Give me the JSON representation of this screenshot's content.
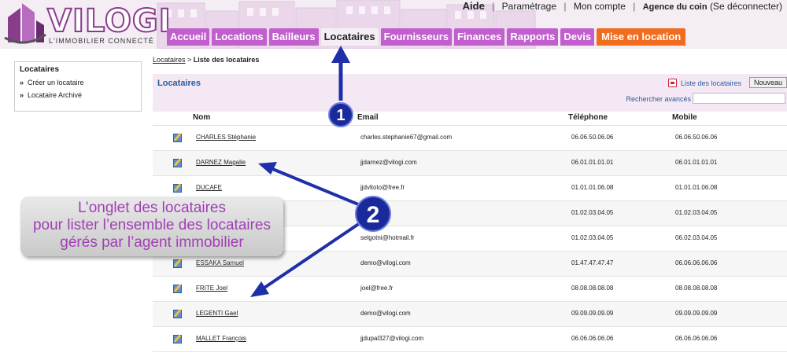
{
  "header": {
    "logo_text": "VILOGI",
    "logo_tagline": "L'IMMOBILIER CONNECTÉ",
    "top_links": [
      "Aide",
      "Paramétrage",
      "Mon compte"
    ],
    "agency_text": "Agence du coin",
    "logout_text": "(Se déconnecter)"
  },
  "tabs": [
    {
      "label": "Accueil"
    },
    {
      "label": "Locations"
    },
    {
      "label": "Bailleurs"
    },
    {
      "label": "Locataires"
    },
    {
      "label": "Fournisseurs"
    },
    {
      "label": "Finances"
    },
    {
      "label": "Rapports"
    },
    {
      "label": "Devis"
    },
    {
      "label": "Mise en location"
    }
  ],
  "sidebar": {
    "title": "Locataires",
    "items": [
      {
        "label": "Créer un locataire"
      },
      {
        "label": "Locataire Archivé"
      }
    ]
  },
  "breadcrumb": {
    "link": "Locataires",
    "separator": " > ",
    "current": "Liste des locataires"
  },
  "panel": {
    "title": "Locataires",
    "list_link": "Liste des locataires",
    "new_button": "Nouveau",
    "advanced_search": "Rechercher avancés",
    "columns": {
      "name": "Nom",
      "email": "Email",
      "phone": "Téléphone",
      "mobile": "Mobile"
    }
  },
  "rows": [
    {
      "name": "CHARLES Stéphanie",
      "email": "charles.stephanie67@gmail.com",
      "phone": "06.06.50.06.06",
      "mobile": "06.06.50.06.06"
    },
    {
      "name": "DARNEZ Magalie",
      "email": "jjdarnez@vilogi.com",
      "phone": "06.01.01.01.01",
      "mobile": "06.01.01.01.01"
    },
    {
      "name": "DUCAFE",
      "email": "jjdvltoto@free.fr",
      "phone": "01.01.01.06.08",
      "mobile": "01.01.01.06.08"
    },
    {
      "name": "",
      "email": "jj...gi.com",
      "phone": "01.02.03.04.05",
      "mobile": "01.02.03.04.05"
    },
    {
      "name": "",
      "email": "selgotni@hotmail.fr",
      "phone": "01.02.03.04.05",
      "mobile": "06.02.03.04.05"
    },
    {
      "name": "ESSAKA Samuel",
      "email": "demo@vilogi.com",
      "phone": "01.47.47.47.47",
      "mobile": "06.06.06.06.06"
    },
    {
      "name": "FRITE Joel",
      "email": "joel@free.fr",
      "phone": "08.08.08.08.08",
      "mobile": "08.08.08.08.08"
    },
    {
      "name": "LEGENTI Gael",
      "email": "demo@vilogi.com",
      "phone": "09.09.09.09.09",
      "mobile": "09.09.09.09.09"
    },
    {
      "name": "MALLET François",
      "email": "jjdupal327@vilogi.com",
      "phone": "06.06.06.06.06",
      "mobile": "06.06.06.06.06"
    }
  ],
  "annotations": {
    "badge1": "1",
    "badge2": "2",
    "callout_lines": [
      "L’onglet des locataires",
      "pour lister l’ensemble des locataires",
      "gérés par l’agent immobilier"
    ],
    "arrow_color": "#1f2fa8"
  }
}
